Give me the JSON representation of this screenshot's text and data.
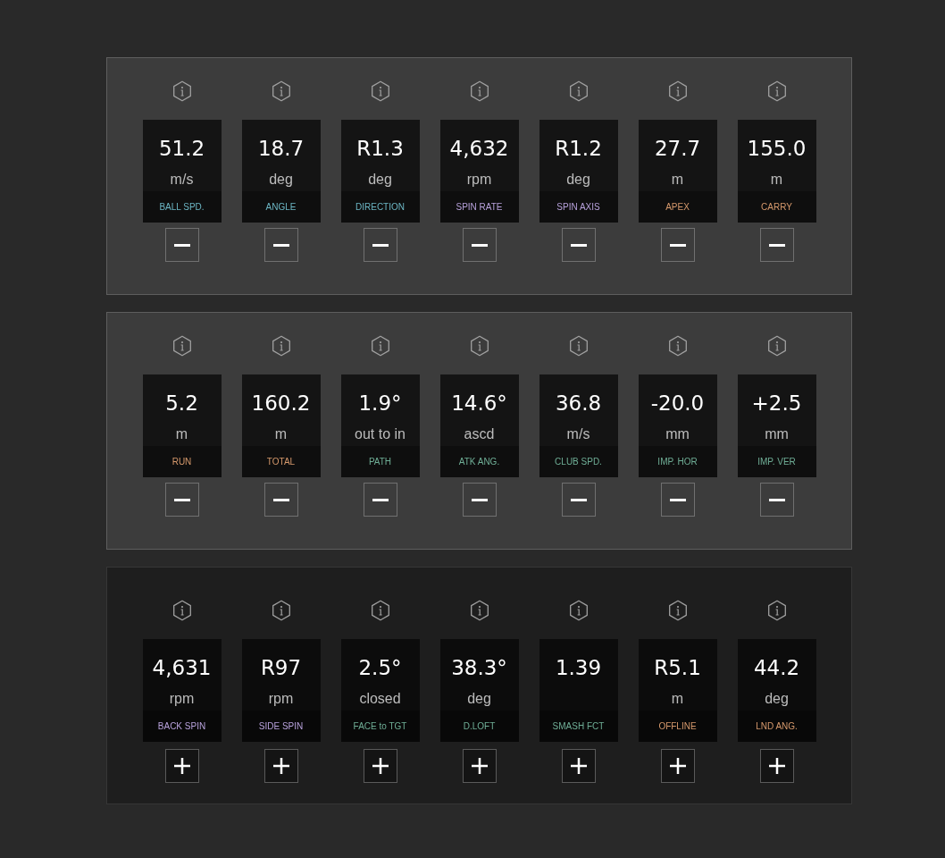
{
  "panels": [
    {
      "active": true,
      "metrics": [
        {
          "value": "51.2",
          "unit": "m/s",
          "label": "BALL SPD.",
          "color": "#6cb6c4"
        },
        {
          "value": "18.7",
          "unit": "deg",
          "label": "ANGLE",
          "color": "#6cb6c4"
        },
        {
          "value": "R1.3",
          "unit": "deg",
          "label": "DIRECTION",
          "color": "#6cb6c4"
        },
        {
          "value": "4,632",
          "unit": "rpm",
          "label": "SPIN RATE",
          "color": "#b8a2dc"
        },
        {
          "value": "R1.2",
          "unit": "deg",
          "label": "SPIN AXIS",
          "color": "#b8a2dc"
        },
        {
          "value": "27.7",
          "unit": "m",
          "label": "APEX",
          "color": "#d6996c"
        },
        {
          "value": "155.0",
          "unit": "m",
          "label": "CARRY",
          "color": "#d6996c"
        }
      ]
    },
    {
      "active": true,
      "metrics": [
        {
          "value": "5.2",
          "unit": "m",
          "label": "RUN",
          "color": "#d6996c"
        },
        {
          "value": "160.2",
          "unit": "m",
          "label": "TOTAL",
          "color": "#d6996c"
        },
        {
          "value": "1.9°",
          "unit": "out to in",
          "label": "PATH",
          "color": "#6fae96"
        },
        {
          "value": "14.6°",
          "unit": "ascd",
          "label": "ATK ANG.",
          "color": "#6fae96"
        },
        {
          "value": "36.8",
          "unit": "m/s",
          "label": "CLUB SPD.",
          "color": "#6fae96"
        },
        {
          "value": "-20.0",
          "unit": "mm",
          "label": "IMP. HOR",
          "color": "#6fae96"
        },
        {
          "value": "+2.5",
          "unit": "mm",
          "label": "IMP. VER",
          "color": "#6fae96"
        }
      ]
    },
    {
      "active": false,
      "metrics": [
        {
          "value": "4,631",
          "unit": "rpm",
          "label": "BACK SPIN",
          "color": "#b8a2dc"
        },
        {
          "value": "R97",
          "unit": "rpm",
          "label": "SIDE SPIN",
          "color": "#b8a2dc"
        },
        {
          "value": "2.5°",
          "unit": "closed",
          "label": "FACE to TGT",
          "color": "#6fae96"
        },
        {
          "value": "38.3°",
          "unit": "deg",
          "label": "D.LOFT",
          "color": "#6fae96"
        },
        {
          "value": "1.39",
          "label": "SMASH FCT",
          "color": "#6fae96"
        },
        {
          "value": "R5.1",
          "unit": "m",
          "label": "OFFLINE",
          "color": "#d6996c"
        },
        {
          "value": "44.2",
          "unit": "deg",
          "label": "LND ANG.",
          "color": "#d6996c"
        }
      ]
    }
  ]
}
